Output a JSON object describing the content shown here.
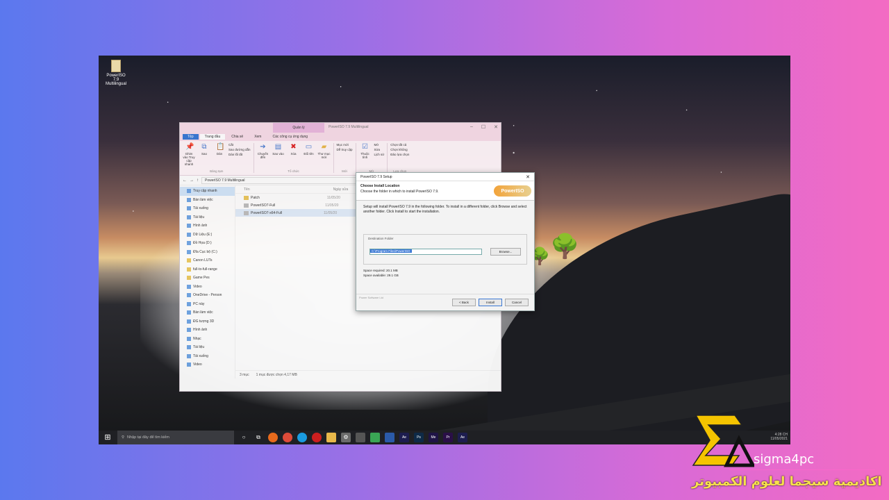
{
  "desktop": {
    "icon_label": "PowerISO 7.9 Multilingual"
  },
  "explorer": {
    "context_tab": "Quản lý",
    "window_title": "PowerISO 7.9 Multilingual",
    "tabs": [
      "Tệp",
      "Trang đầu",
      "Chia sẻ",
      "Xem",
      "Các công cụ ứng dụng"
    ],
    "ribbon": {
      "clipboard_items": [
        "Ghim vào Truy cập nhanh",
        "Sao",
        "Dán"
      ],
      "clipboard_small": [
        "Cắt",
        "Sao đường dẫn",
        "Dán lối tắt"
      ],
      "clipboard_label": "Bảng tạm",
      "organize_items": [
        "Chuyển đến",
        "Sao vào",
        "Xóa",
        "Đổi tên",
        "Thư mục mới"
      ],
      "organize_label": "Tổ chức",
      "new_small": [
        "Mục mới",
        "Dễ truy cập"
      ],
      "new_label": "Mới",
      "open_items": [
        "Thuộc tính"
      ],
      "open_small": [
        "Mở",
        "Sửa",
        "Lịch sử"
      ],
      "open_label": "Mở",
      "select_small": [
        "Chọn tất cả",
        "Chọn không",
        "Đảo lựa chọn"
      ],
      "select_label": "Lựa chọn"
    },
    "address": "PowerISO 7.9 Multilingual",
    "nav": [
      "Truy cập nhanh",
      "Bàn làm việc",
      "Tải xuống",
      "Tài liệu",
      "Hình ảnh",
      "Dữ Liệu (E:)",
      "Đồ Họa (D:)",
      "Đĩa Cục bộ (C:)",
      "Canon LUTs",
      "full-to-full-range",
      "Game Pes",
      "Video",
      "OneDrive - Person",
      "PC này",
      "Bàn làm việc",
      "ĐG tượng 3D",
      "Hình ảnh",
      "Nhạc",
      "Tài liệu",
      "Tải xuống",
      "Video"
    ],
    "column_name": "Tên",
    "column_date": "Ngày sửa",
    "files": [
      {
        "name": "Patch",
        "date": "11/05/20"
      },
      {
        "name": "PowerISO7-Full",
        "date": "11/05/20"
      },
      {
        "name": "PowerISO7-x64-Full",
        "date": "11/05/20"
      }
    ],
    "status_count": "3 mục",
    "status_selection": "1 mục được chọn 4,17 MB"
  },
  "setup": {
    "title": "PowerISO 7.9 Setup",
    "heading": "Choose Install Location",
    "subheading": "Choose the folder in which to install PowerISO 7.9.",
    "logo_text": "PowerISO",
    "description": "Setup will install PowerISO 7.9 in the following folder. To install in a different folder, click Browse and select another folder. Click Install to start the installation.",
    "destination_label": "Destination Folder",
    "destination_path": "C:\\Program Files\\PowerISO",
    "browse_label": "Browse...",
    "space_required": "Space required: 20.1 MB",
    "space_available": "Space available: 29.1 GB",
    "footer_brand": "Power Software Ltd",
    "back_label": "< Back",
    "install_label": "Install",
    "cancel_label": "Cancel"
  },
  "taskbar": {
    "search_placeholder": "Nhập tại đây để tìm kiếm",
    "apps": [
      "Ae",
      "Ps",
      "Me",
      "Pr",
      "Ae"
    ],
    "clock_time": "4:28 CH",
    "clock_date": "11/05/2021"
  },
  "branding": {
    "site": "sigma4pc",
    "arabic": "اكاديمية سيجما لعلوم الكمبيوتر",
    "accent": "#f5c400"
  }
}
